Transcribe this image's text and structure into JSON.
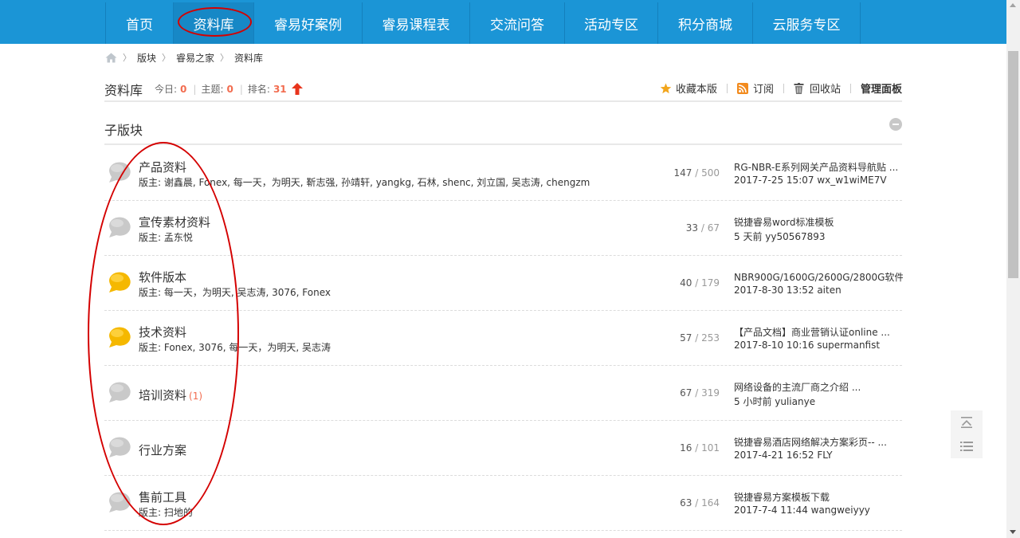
{
  "nav": {
    "items": [
      {
        "label": "首页"
      },
      {
        "label": "资料库"
      },
      {
        "label": "睿易好案例"
      },
      {
        "label": "睿易课程表"
      },
      {
        "label": "交流问答"
      },
      {
        "label": "活动专区"
      },
      {
        "label": "积分商城"
      },
      {
        "label": "云服务专区"
      }
    ],
    "active_index": 1
  },
  "breadcrumb": {
    "icon": "home-icon",
    "items": [
      "版块",
      "睿易之家",
      "资料库"
    ]
  },
  "forum": {
    "title": "资料库",
    "today_label": "今日:",
    "today_value": "0",
    "topics_label": "主题:",
    "topics_value": "0",
    "rank_label": "排名:",
    "rank_value": "31",
    "actions": {
      "favorite": "收藏本版",
      "subscribe": "订阅",
      "recycle": "回收站",
      "admin": "管理面板"
    }
  },
  "subforums": {
    "title": "子版块",
    "items": [
      {
        "name": "产品资料",
        "today": "",
        "mods": "版主: 谢鑫晨, Fonex, 每一天，为明天, 靳志强, 孙靖轩, yangkg, 石林, shenc, 刘立国, 吴志涛, chengzm",
        "threads": "147",
        "posts": "500",
        "last_title": "RG-NBR-E系列网关产品资料导航贴 ...",
        "last_meta": "2017-7-25 15:07 wx_w1wiME7V",
        "new": false
      },
      {
        "name": "宣传素材资料",
        "today": "",
        "mods": "版主: 孟东悦",
        "threads": "33",
        "posts": "67",
        "last_title": "锐捷睿易word标准模板",
        "last_meta": "5 天前 yy50567893",
        "new": false
      },
      {
        "name": "软件版本",
        "today": "",
        "mods": "版主: 每一天，为明天, 吴志涛, 3076, Fonex",
        "threads": "40",
        "posts": "179",
        "last_title": "NBR900G/1600G/2600G/2800G软件...",
        "last_meta": "2017-8-30 13:52 aiten",
        "new": true
      },
      {
        "name": "技术资料",
        "today": "",
        "mods": "版主: Fonex, 3076, 每一天，为明天, 吴志涛",
        "threads": "57",
        "posts": "253",
        "last_title": "【产品文档】商业营销认证online ...",
        "last_meta": "2017-8-10 10:16 supermanfist",
        "new": true
      },
      {
        "name": "培训资料",
        "today": "(1)",
        "mods": "",
        "threads": "67",
        "posts": "319",
        "last_title": "网络设备的主流厂商之介绍 ...",
        "last_meta": "5 小时前 yulianye",
        "new": false
      },
      {
        "name": "行业方案",
        "today": "",
        "mods": "",
        "threads": "16",
        "posts": "101",
        "last_title": "锐捷睿易酒店网络解决方案彩页-- ...",
        "last_meta": "2017-4-21 16:52 FLY",
        "new": false
      },
      {
        "name": "售前工具",
        "today": "",
        "mods": "版主: 扫地的",
        "threads": "63",
        "posts": "164",
        "last_title": "锐捷睿易方案模板下载",
        "last_meta": "2017-7-4 11:44 wangweiyyy",
        "new": false
      }
    ]
  },
  "colors": {
    "nav_bg": "#1b95d6",
    "accent_red": "#f26c4f",
    "annotation_red": "#d40000",
    "bubble_new": "#f5b800",
    "bubble_old": "#c9c9c9"
  }
}
